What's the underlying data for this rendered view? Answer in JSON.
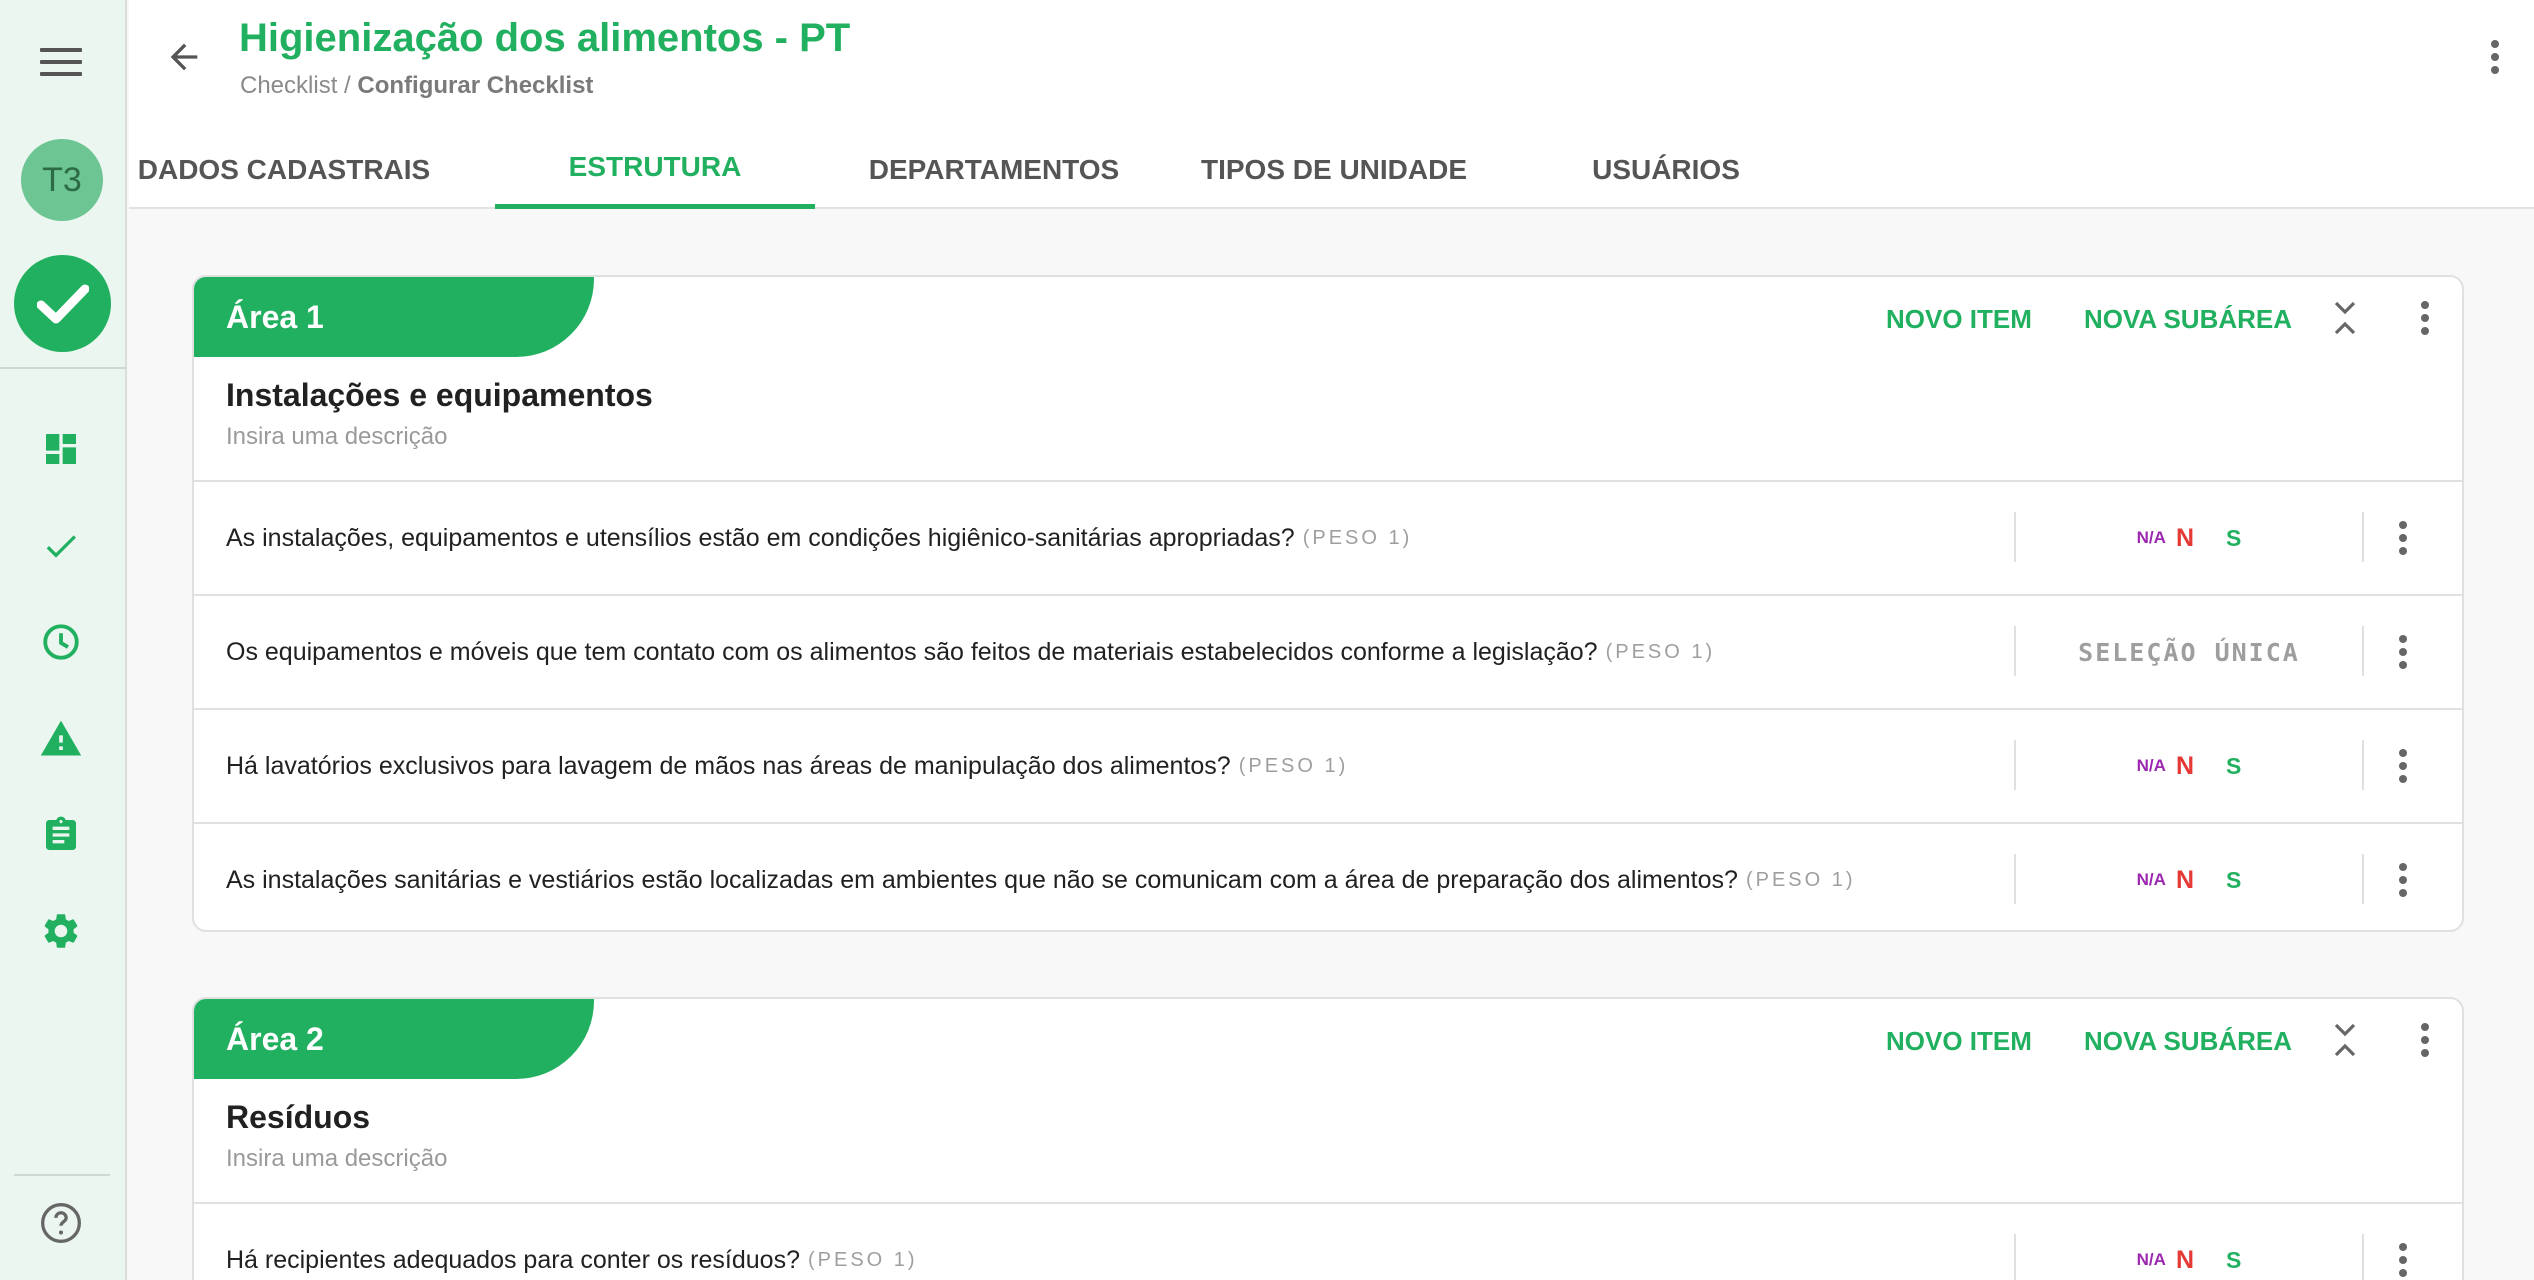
{
  "sidebar": {
    "avatar_initials": "T3",
    "icons": [
      "dashboard-icon",
      "check-icon",
      "clock-icon",
      "warning-icon",
      "clipboard-icon",
      "settings-icon"
    ],
    "help_icon": "help-icon"
  },
  "header": {
    "title": "Higienização dos alimentos - PT",
    "breadcrumb_root": "Checklist / ",
    "breadcrumb_current": "Configurar Checklist"
  },
  "tabs": [
    {
      "label": "DADOS CADASTRAIS",
      "active": false
    },
    {
      "label": "ESTRUTURA",
      "active": true
    },
    {
      "label": "DEPARTAMENTOS",
      "active": false
    },
    {
      "label": "TIPOS DE UNIDADE",
      "active": false
    },
    {
      "label": "USUÁRIOS",
      "active": false
    }
  ],
  "actions": {
    "new_item": "NOVO ITEM",
    "new_subarea": "NOVA SUBÁREA"
  },
  "areas": [
    {
      "label": "Área 1",
      "name": "Instalações e equipamentos",
      "description_placeholder": "Insira uma descrição",
      "items": [
        {
          "text": "As instalações, equipamentos e utensílios estão em condições higiênico-sanitárias apropriadas?",
          "weight": "(PESO 1)",
          "na": "N/A",
          "n": "N",
          "s": "S"
        },
        {
          "text": "Os equipamentos e móveis que tem contato com os alimentos são feitos de materiais estabelecidos conforme a legislação?",
          "weight": "(PESO 1)",
          "response_type": "SELEÇÃO ÚNICA"
        },
        {
          "text": "Há lavatórios exclusivos para lavagem de mãos nas áreas de manipulação dos alimentos?",
          "weight": "(PESO 1)",
          "na": "N/A",
          "n": "N",
          "s": "S"
        },
        {
          "text": "As instalações sanitárias e vestiários estão localizadas em ambientes que não se comunicam com a área de preparação dos alimentos?",
          "weight": "(PESO 1)",
          "na": "N/A",
          "n": "N",
          "s": "S"
        }
      ]
    },
    {
      "label": "Área 2",
      "name": "Resíduos",
      "description_placeholder": "Insira uma descrição",
      "items": [
        {
          "text": "Há recipientes adequados para conter os resíduos?",
          "weight": "(PESO 1)",
          "na": "N/A",
          "n": "N",
          "s": "S"
        }
      ]
    }
  ],
  "colors": {
    "primary": "#21b05f",
    "na": "#9c27b0",
    "no": "#e53935",
    "sidebar_bg": "#eaf6ef"
  }
}
